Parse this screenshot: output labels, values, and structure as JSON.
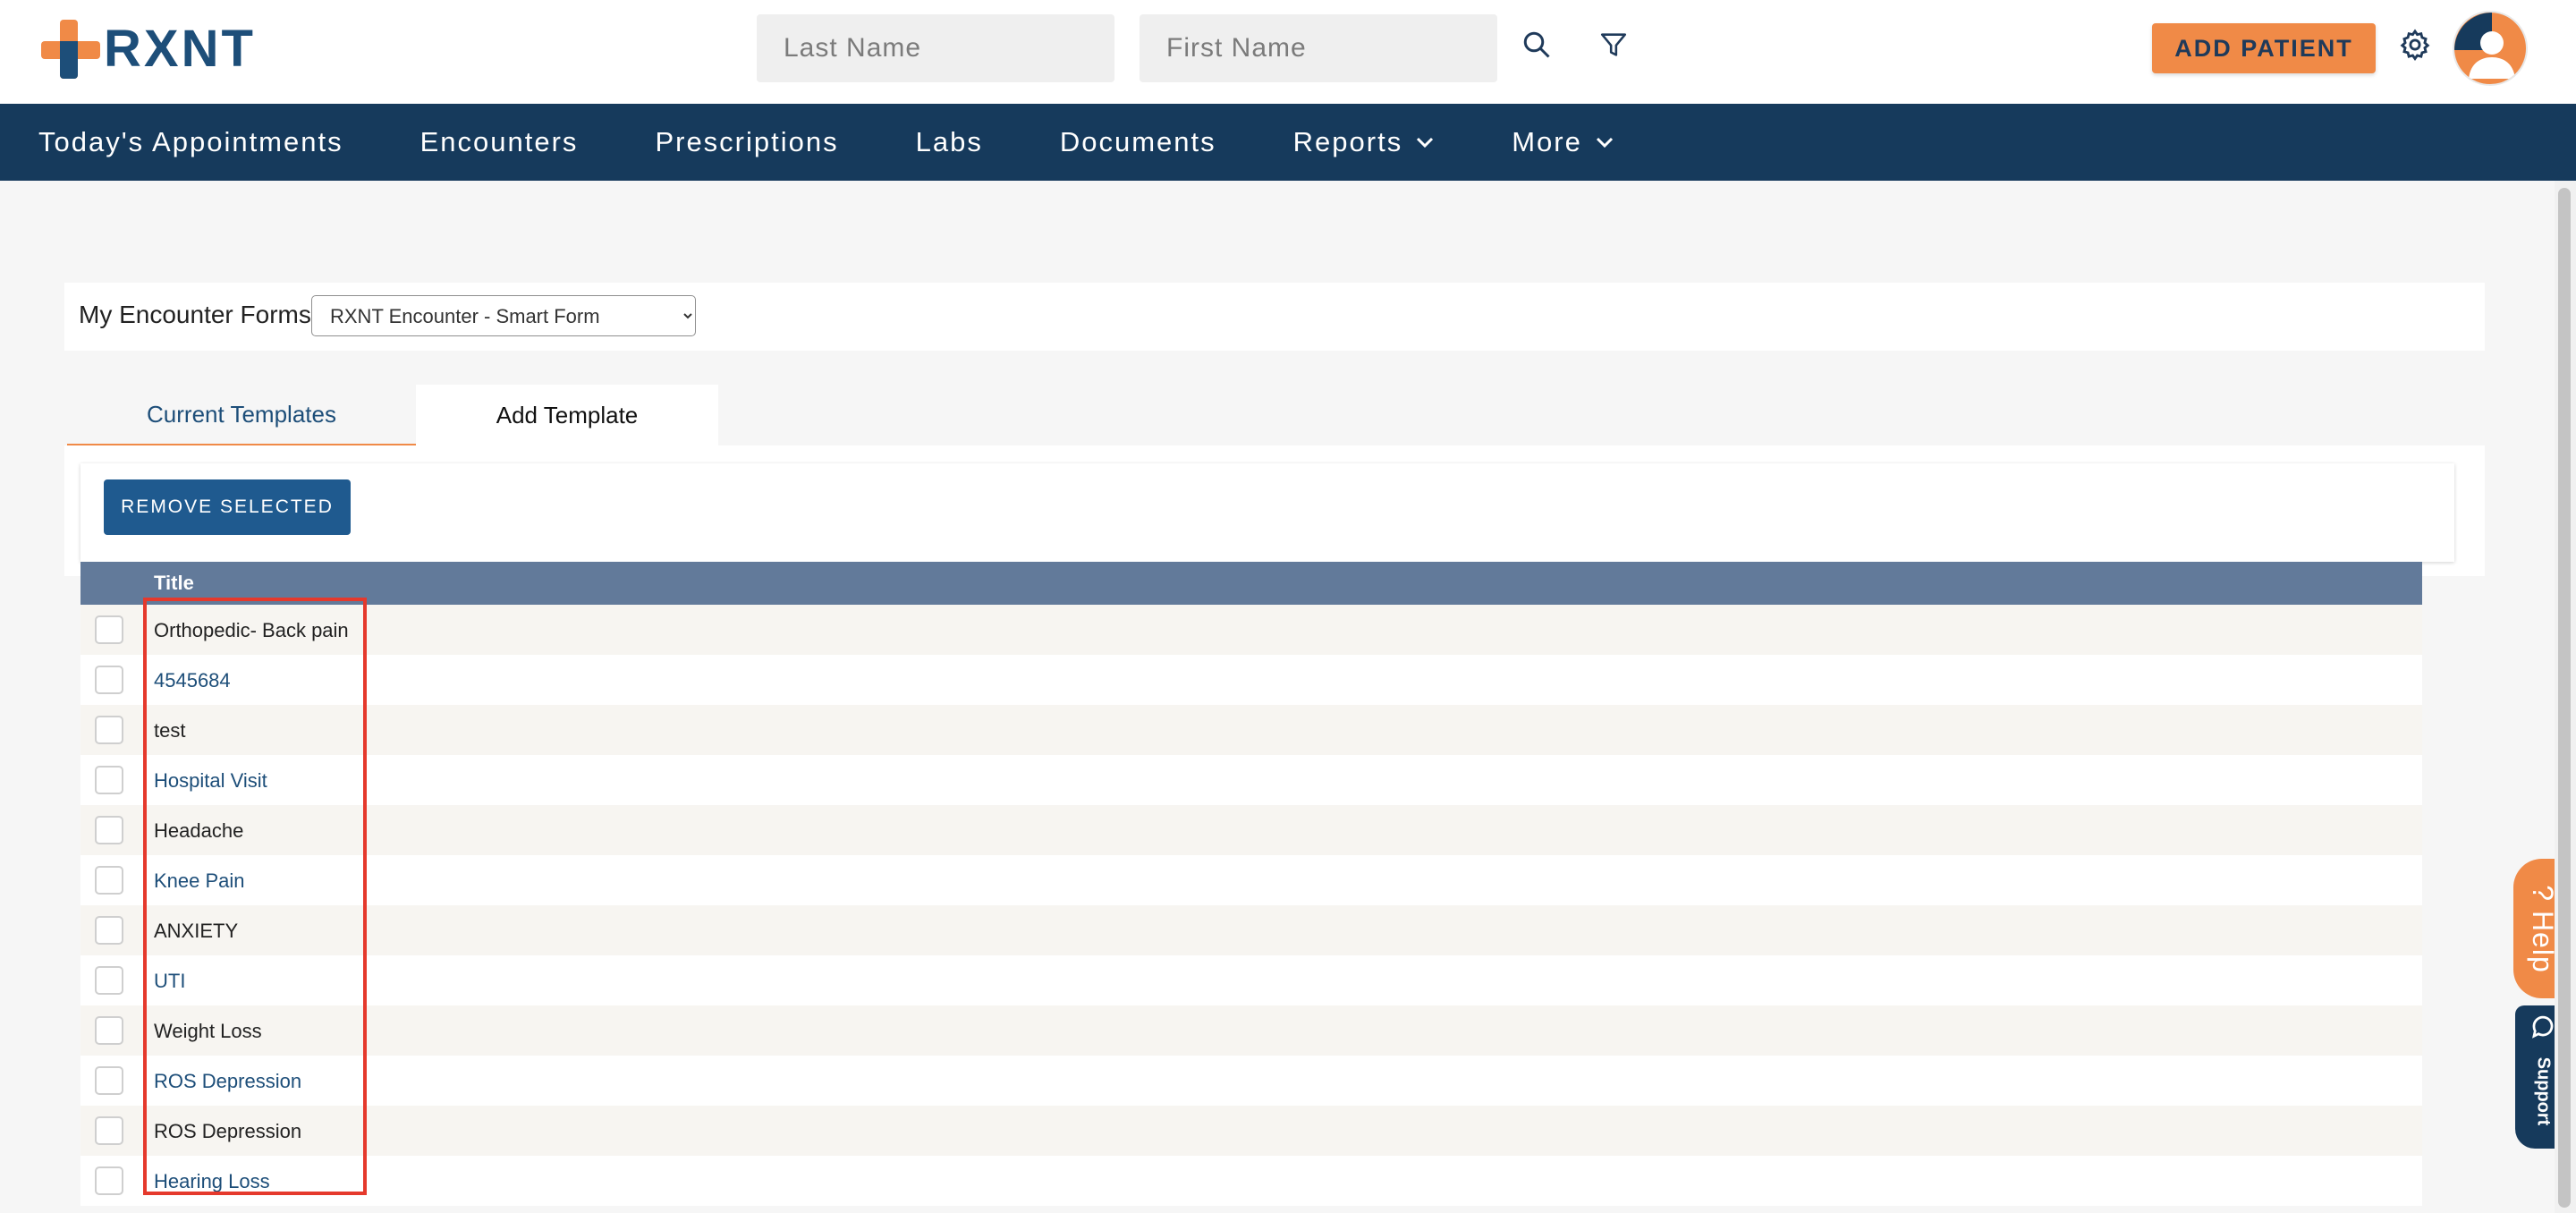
{
  "header": {
    "logo_text": "RXNT",
    "last_name_placeholder": "Last Name",
    "first_name_placeholder": "First Name",
    "add_patient_label": "ADD PATIENT"
  },
  "nav": {
    "items": [
      {
        "label": "Today's Appointments"
      },
      {
        "label": "Encounters"
      },
      {
        "label": "Prescriptions"
      },
      {
        "label": "Labs"
      },
      {
        "label": "Documents"
      },
      {
        "label": "Reports"
      },
      {
        "label": "More"
      }
    ]
  },
  "encounter_forms": {
    "label": "My Encounter Forms:",
    "selected": "RXNT Encounter - Smart Form"
  },
  "tabs": {
    "current": "Current Templates",
    "add": "Add Template"
  },
  "toolbar": {
    "remove_selected_label": "REMOVE SELECTED"
  },
  "table": {
    "column_title": "Title",
    "rows": [
      {
        "title": "Orthopedic- Back pain"
      },
      {
        "title": "4545684"
      },
      {
        "title": "test"
      },
      {
        "title": "Hospital Visit"
      },
      {
        "title": "Headache"
      },
      {
        "title": "Knee Pain"
      },
      {
        "title": "ANXIETY"
      },
      {
        "title": "UTI"
      },
      {
        "title": "Weight Loss"
      },
      {
        "title": "ROS Depression"
      },
      {
        "title": "ROS Depression"
      },
      {
        "title": "Hearing Loss"
      }
    ]
  },
  "widgets": {
    "help_label": "? Help",
    "support_label": "Support"
  },
  "colors": {
    "brand_navy": "#163a5c",
    "brand_orange": "#f08a47",
    "table_header": "#627a9a",
    "highlight": "#e5392c"
  }
}
